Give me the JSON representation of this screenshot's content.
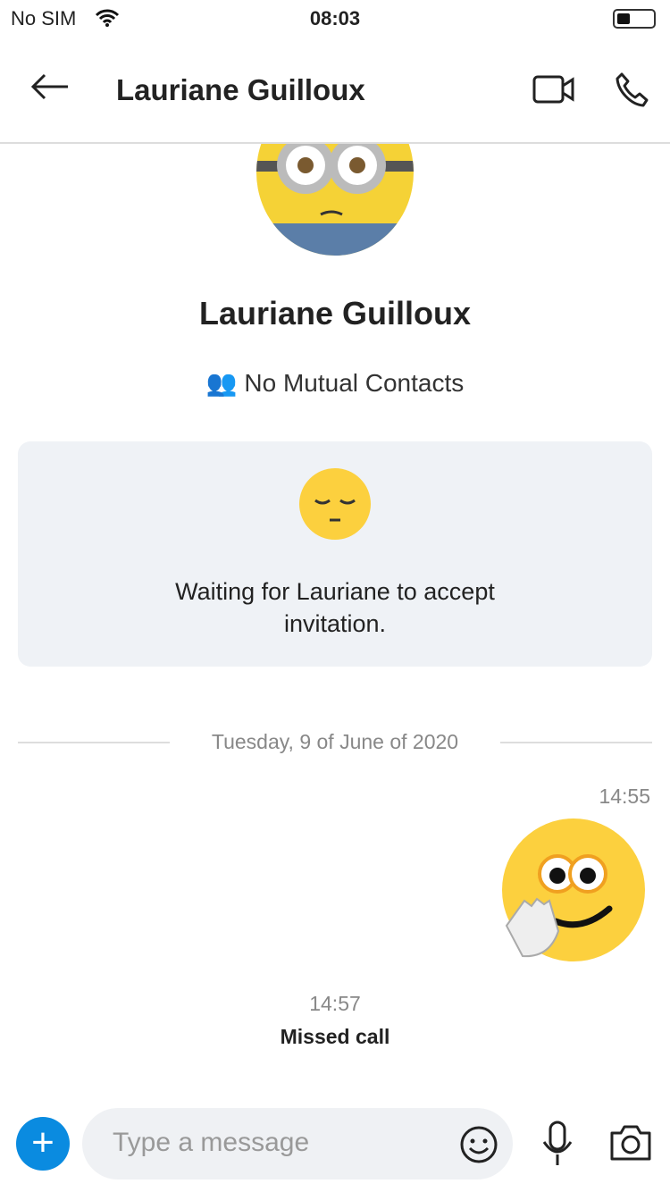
{
  "status": {
    "carrier": "No SIM",
    "time": "08:03"
  },
  "header": {
    "title": "Lauriane Guilloux",
    "back_icon": "arrow-left-icon",
    "video_icon": "video-camera-icon",
    "call_icon": "phone-icon"
  },
  "profile": {
    "name": "Lauriane Guilloux",
    "mutual": "No Mutual Contacts"
  },
  "invite": {
    "text": "Waiting for Lauriane to accept invitation."
  },
  "chat": {
    "date": "Tuesday, 9 of June of 2020",
    "messages": [
      {
        "time": "14:55",
        "content": "waving emoticon"
      },
      {
        "time": "14:57",
        "text": "Missed call"
      }
    ]
  },
  "composer": {
    "placeholder": "Type a message",
    "plus": "+"
  },
  "colors": {
    "accent": "#0a8be0",
    "card": "#eff2f6"
  }
}
